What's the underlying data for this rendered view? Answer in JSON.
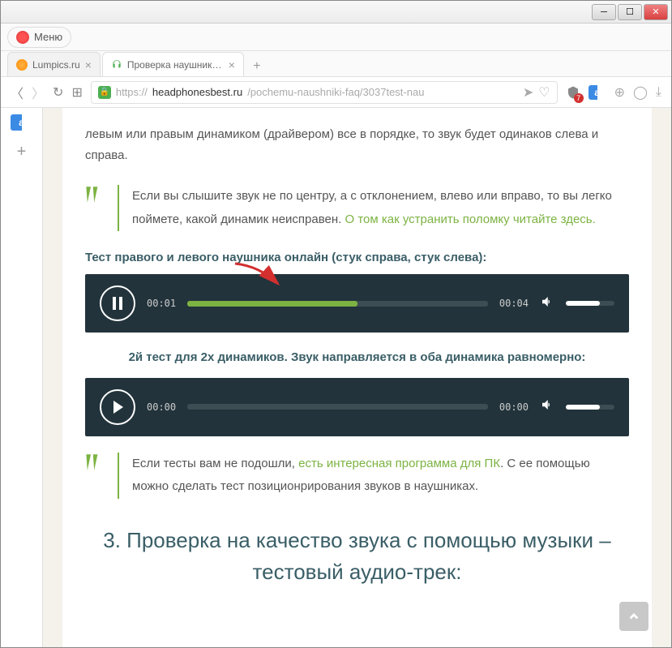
{
  "menu": {
    "label": "Меню"
  },
  "tabs": [
    {
      "title": "Lumpics.ru"
    },
    {
      "title": "Проверка наушников му"
    }
  ],
  "url": {
    "domain": "headphonesbest.ru",
    "path": "/pochemu-naushniki-faq/3037test-nau",
    "prefix": "https://"
  },
  "badge": "7",
  "page": {
    "intro": "левым или правым динамиком (драйвером) все в порядке, то звук будет одинаков слева и справа.",
    "quote1_text": "Если вы слышите звук не по центру, а с отклонением, влево или вправо, то вы легко поймете, какой динамик неисправен. ",
    "quote1_link": "О том как устранить поломку читайте здесь.",
    "test1_label": "Тест правого и левого наушника онлайн (стук справа, стук слева):",
    "player1": {
      "current": "00:01",
      "total": "00:04",
      "progress_pct": 56.5
    },
    "test2_label": "2й тест для 2х динамиков. Звук направляется в оба динамика равномерно:",
    "player2": {
      "current": "00:00",
      "total": "00:00",
      "progress_pct": 0
    },
    "quote2_pre": "Если тесты вам не подошли, ",
    "quote2_link": "есть интересная программа для ПК",
    "quote2_post": ". С ее помощью можно сделать тест позиционрирования звуков в наушниках.",
    "heading3": "3. Проверка на качество звука с помощью музыки – тестовый аудио-трек:"
  }
}
